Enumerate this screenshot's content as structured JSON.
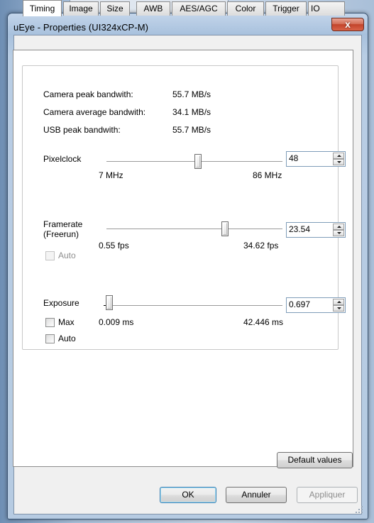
{
  "window": {
    "title": "uEye - Properties (UI324xCP-M)",
    "close_glyph": "x"
  },
  "tabs": [
    {
      "label": "Timing",
      "active": true
    },
    {
      "label": "Image"
    },
    {
      "label": "Size"
    },
    {
      "label": "AWB"
    },
    {
      "label": "AES/AGC"
    },
    {
      "label": "Color"
    },
    {
      "label": "Trigger"
    },
    {
      "label": "IO"
    }
  ],
  "bandwidth": {
    "peak_label": "Camera peak bandwith:",
    "peak_value": "55.7 MB/s",
    "avg_label": "Camera average bandwith:",
    "avg_value": "34.1 MB/s",
    "usb_label": "USB peak bandwith:",
    "usb_value": "55.7 MB/s"
  },
  "pixelclock": {
    "label": "Pixelclock",
    "min_label": "7 MHz",
    "max_label": "86 MHz",
    "value": "48",
    "min": 7,
    "max": 86,
    "current": 48
  },
  "framerate": {
    "label_line1": "Framerate",
    "label_line2": "(Freerun)",
    "auto_label": "Auto",
    "auto_checked": false,
    "auto_enabled": false,
    "min_label": "0.55 fps",
    "max_label": "34.62 fps",
    "value": "23.54",
    "min": 0.55,
    "max": 34.62,
    "current": 23.54
  },
  "exposure": {
    "label": "Exposure",
    "max_label": "Max",
    "auto_label": "Auto",
    "max_checked": false,
    "auto_checked": false,
    "min_label": "0.009 ms",
    "max_range_label": "42.446 ms",
    "value": "0.697",
    "min": 0.009,
    "max": 42.446,
    "current": 0.697
  },
  "buttons": {
    "default_values": "Default values",
    "ok": "OK",
    "cancel": "Annuler",
    "apply": "Appliquer"
  },
  "colors": {
    "accent": "#3c7fb1",
    "close": "#c2432a",
    "disabled_text": "#8d8d8d"
  }
}
